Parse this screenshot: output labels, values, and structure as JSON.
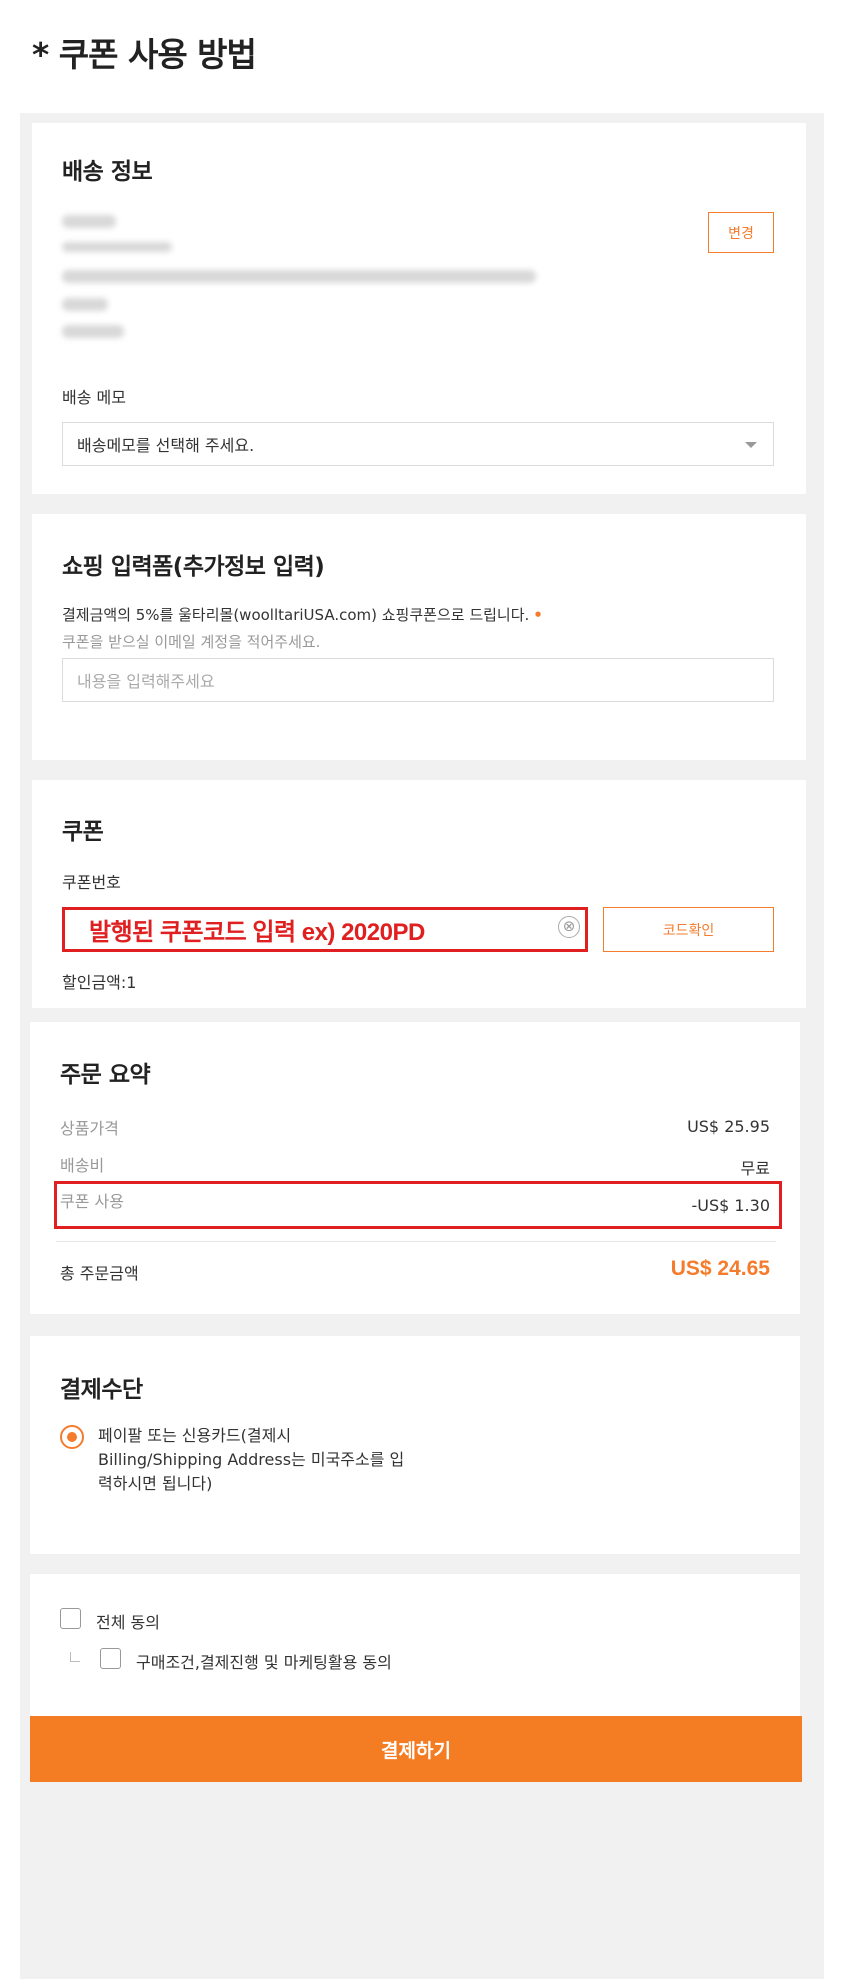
{
  "page_title": "* 쿠폰 사용 방법",
  "shipping": {
    "title": "배송 정보",
    "change_label": "변경",
    "memo_label": "배송 메모",
    "memo_select_value": "배송메모를 선택해 주세요."
  },
  "shopping_form": {
    "title": "쇼핑 입력폼(추가정보 입력)",
    "description": "결제금액의 5%를 울타리몰(woolltariUSA.com) 쇼핑쿠폰으로 드립니다.",
    "required_mark": "•",
    "sub_description": "쿠폰을 받으실 이메일 계정을 적어주세요.",
    "input_placeholder": "내용을 입력해주세요"
  },
  "coupon": {
    "title": "쿠폰",
    "number_label": "쿠폰번호",
    "input_value": "발행된 쿠폰코드 입력  ex) 2020PD",
    "clear_icon": "⊗",
    "check_button_label": "코드확인",
    "discount_text": "할인금액:1"
  },
  "order_summary": {
    "title": "주문 요약",
    "rows": [
      {
        "label": "상품가격",
        "value": "US$ 25.95"
      },
      {
        "label": "배송비",
        "value": "무료"
      },
      {
        "label": "쿠폰 사용",
        "value": "-US$ 1.30"
      }
    ],
    "total_label": "총 주문금액",
    "total_value": "US$ 24.65"
  },
  "payment": {
    "title": "결제수단",
    "option_label": "페이팔 또는 신용카드(결제시 Billing/Shipping Address는 미국주소를 입력하시면 됩니다)"
  },
  "agreement": {
    "all_label": "전체 동의",
    "terms_label": "구매조건,결제진행 및 마케팅활용 동의"
  },
  "pay_button_label": "결제하기",
  "colors": {
    "accent": "#f47c22",
    "highlight": "#e02020"
  }
}
